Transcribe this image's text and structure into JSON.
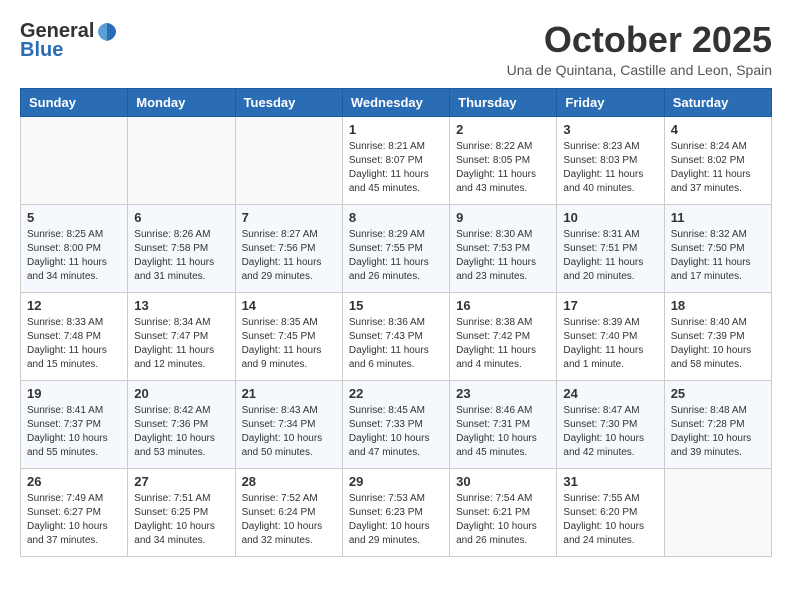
{
  "header": {
    "logo_general": "General",
    "logo_blue": "Blue",
    "month_year": "October 2025",
    "location": "Una de Quintana, Castille and Leon, Spain"
  },
  "calendar": {
    "weekdays": [
      "Sunday",
      "Monday",
      "Tuesday",
      "Wednesday",
      "Thursday",
      "Friday",
      "Saturday"
    ],
    "weeks": [
      [
        {
          "day": "",
          "info": ""
        },
        {
          "day": "",
          "info": ""
        },
        {
          "day": "",
          "info": ""
        },
        {
          "day": "1",
          "info": "Sunrise: 8:21 AM\nSunset: 8:07 PM\nDaylight: 11 hours and 45 minutes."
        },
        {
          "day": "2",
          "info": "Sunrise: 8:22 AM\nSunset: 8:05 PM\nDaylight: 11 hours and 43 minutes."
        },
        {
          "day": "3",
          "info": "Sunrise: 8:23 AM\nSunset: 8:03 PM\nDaylight: 11 hours and 40 minutes."
        },
        {
          "day": "4",
          "info": "Sunrise: 8:24 AM\nSunset: 8:02 PM\nDaylight: 11 hours and 37 minutes."
        }
      ],
      [
        {
          "day": "5",
          "info": "Sunrise: 8:25 AM\nSunset: 8:00 PM\nDaylight: 11 hours and 34 minutes."
        },
        {
          "day": "6",
          "info": "Sunrise: 8:26 AM\nSunset: 7:58 PM\nDaylight: 11 hours and 31 minutes."
        },
        {
          "day": "7",
          "info": "Sunrise: 8:27 AM\nSunset: 7:56 PM\nDaylight: 11 hours and 29 minutes."
        },
        {
          "day": "8",
          "info": "Sunrise: 8:29 AM\nSunset: 7:55 PM\nDaylight: 11 hours and 26 minutes."
        },
        {
          "day": "9",
          "info": "Sunrise: 8:30 AM\nSunset: 7:53 PM\nDaylight: 11 hours and 23 minutes."
        },
        {
          "day": "10",
          "info": "Sunrise: 8:31 AM\nSunset: 7:51 PM\nDaylight: 11 hours and 20 minutes."
        },
        {
          "day": "11",
          "info": "Sunrise: 8:32 AM\nSunset: 7:50 PM\nDaylight: 11 hours and 17 minutes."
        }
      ],
      [
        {
          "day": "12",
          "info": "Sunrise: 8:33 AM\nSunset: 7:48 PM\nDaylight: 11 hours and 15 minutes."
        },
        {
          "day": "13",
          "info": "Sunrise: 8:34 AM\nSunset: 7:47 PM\nDaylight: 11 hours and 12 minutes."
        },
        {
          "day": "14",
          "info": "Sunrise: 8:35 AM\nSunset: 7:45 PM\nDaylight: 11 hours and 9 minutes."
        },
        {
          "day": "15",
          "info": "Sunrise: 8:36 AM\nSunset: 7:43 PM\nDaylight: 11 hours and 6 minutes."
        },
        {
          "day": "16",
          "info": "Sunrise: 8:38 AM\nSunset: 7:42 PM\nDaylight: 11 hours and 4 minutes."
        },
        {
          "day": "17",
          "info": "Sunrise: 8:39 AM\nSunset: 7:40 PM\nDaylight: 11 hours and 1 minute."
        },
        {
          "day": "18",
          "info": "Sunrise: 8:40 AM\nSunset: 7:39 PM\nDaylight: 10 hours and 58 minutes."
        }
      ],
      [
        {
          "day": "19",
          "info": "Sunrise: 8:41 AM\nSunset: 7:37 PM\nDaylight: 10 hours and 55 minutes."
        },
        {
          "day": "20",
          "info": "Sunrise: 8:42 AM\nSunset: 7:36 PM\nDaylight: 10 hours and 53 minutes."
        },
        {
          "day": "21",
          "info": "Sunrise: 8:43 AM\nSunset: 7:34 PM\nDaylight: 10 hours and 50 minutes."
        },
        {
          "day": "22",
          "info": "Sunrise: 8:45 AM\nSunset: 7:33 PM\nDaylight: 10 hours and 47 minutes."
        },
        {
          "day": "23",
          "info": "Sunrise: 8:46 AM\nSunset: 7:31 PM\nDaylight: 10 hours and 45 minutes."
        },
        {
          "day": "24",
          "info": "Sunrise: 8:47 AM\nSunset: 7:30 PM\nDaylight: 10 hours and 42 minutes."
        },
        {
          "day": "25",
          "info": "Sunrise: 8:48 AM\nSunset: 7:28 PM\nDaylight: 10 hours and 39 minutes."
        }
      ],
      [
        {
          "day": "26",
          "info": "Sunrise: 7:49 AM\nSunset: 6:27 PM\nDaylight: 10 hours and 37 minutes."
        },
        {
          "day": "27",
          "info": "Sunrise: 7:51 AM\nSunset: 6:25 PM\nDaylight: 10 hours and 34 minutes."
        },
        {
          "day": "28",
          "info": "Sunrise: 7:52 AM\nSunset: 6:24 PM\nDaylight: 10 hours and 32 minutes."
        },
        {
          "day": "29",
          "info": "Sunrise: 7:53 AM\nSunset: 6:23 PM\nDaylight: 10 hours and 29 minutes."
        },
        {
          "day": "30",
          "info": "Sunrise: 7:54 AM\nSunset: 6:21 PM\nDaylight: 10 hours and 26 minutes."
        },
        {
          "day": "31",
          "info": "Sunrise: 7:55 AM\nSunset: 6:20 PM\nDaylight: 10 hours and 24 minutes."
        },
        {
          "day": "",
          "info": ""
        }
      ]
    ]
  }
}
